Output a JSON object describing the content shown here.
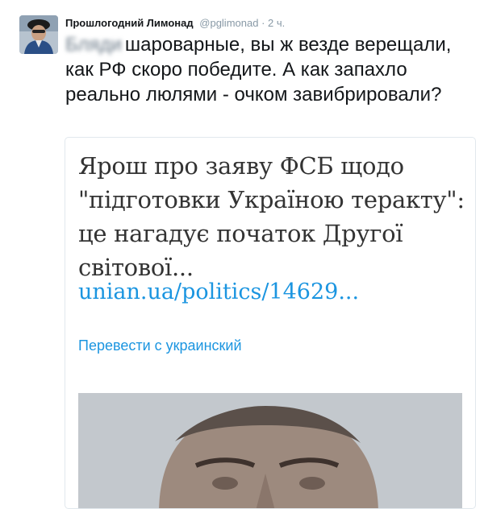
{
  "tweet": {
    "display_name": "Прошлогодний Лимонад",
    "handle": "@pglimonad",
    "separator": "·",
    "time": "2 ч.",
    "text_blurred_word": "Бляди",
    "text": "шароварные, вы ж везде верещали, как РФ скоро победите. А как запахло реально люлями - очком завибрировали?"
  },
  "card": {
    "headline": "Ярош про заяву ФСБ щодо \"підготовки Україною теракту\": це нагадує початок Другої світової...",
    "link": "unian.ua/politics/14629...",
    "translate": "Перевести с украинский"
  }
}
